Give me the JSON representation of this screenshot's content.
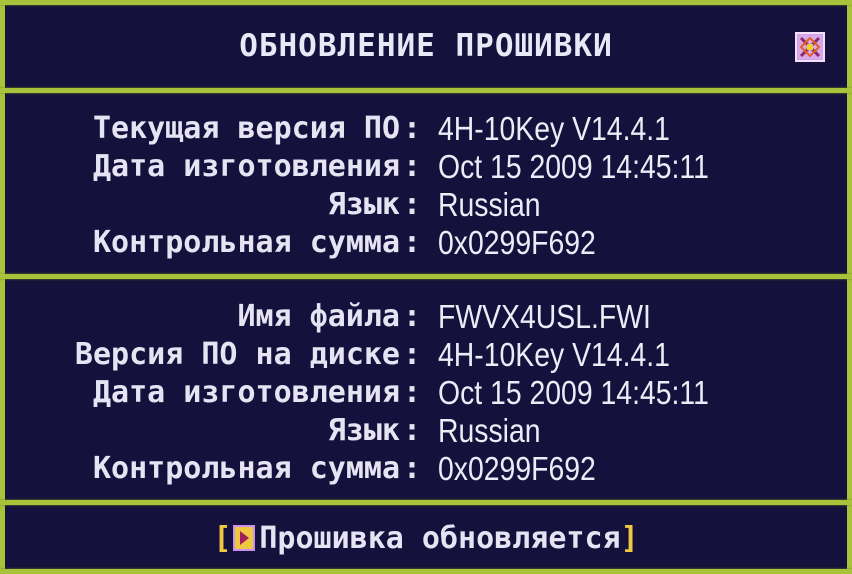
{
  "header": {
    "title": "ОБНОВЛЕНИЕ ПРОШИВКИ",
    "icon": "close-icon"
  },
  "current": {
    "rows": [
      {
        "label": "Текущая версия ПО",
        "value": "4H-10Key V14.4.1"
      },
      {
        "label": "Дата изготовления",
        "value": "Oct 15 2009 14:45:11"
      },
      {
        "label": "Язык",
        "value": "Russian"
      },
      {
        "label": "Контрольная сумма",
        "value": "0x0299F692"
      }
    ]
  },
  "disk": {
    "rows": [
      {
        "label": "Имя файла",
        "value": "FWVX4USL.FWI"
      },
      {
        "label": "Версия ПО на диске",
        "value": "4H-10Key V14.4.1"
      },
      {
        "label": "Дата изготовления",
        "value": "Oct 15 2009 14:45:11"
      },
      {
        "label": "Язык",
        "value": "Russian"
      },
      {
        "label": "Контрольная сумма",
        "value": "0x0299F692"
      }
    ]
  },
  "footer": {
    "open_bracket": "[",
    "status_text": "Прошивка обновляется",
    "close_bracket": "]",
    "icon": "play-icon"
  },
  "colors": {
    "background": "#16144a",
    "border": "#a9c23a",
    "text": "#e6e3f2",
    "accent": "#f0c840"
  }
}
